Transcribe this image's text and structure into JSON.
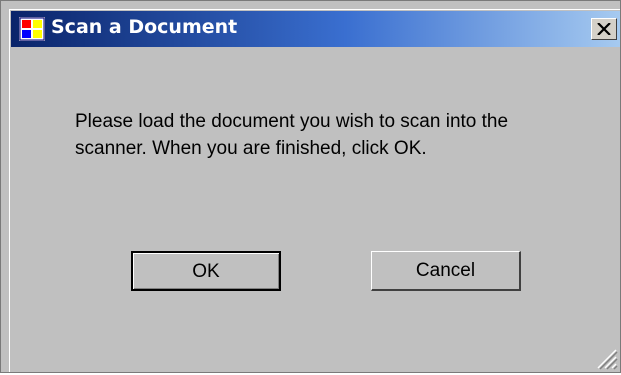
{
  "window": {
    "title": "Scan a Document",
    "close_glyph": "✕",
    "icon": "app-window-icon"
  },
  "message": {
    "text": "Please load the document you wish to scan into the scanner.  When you are finished, click OK."
  },
  "buttons": {
    "ok_label": "OK",
    "cancel_label": "Cancel"
  },
  "colors": {
    "titlebar_start": "#0a246a",
    "titlebar_end": "#a6caf0",
    "dialog_face": "#c0c0c0"
  }
}
